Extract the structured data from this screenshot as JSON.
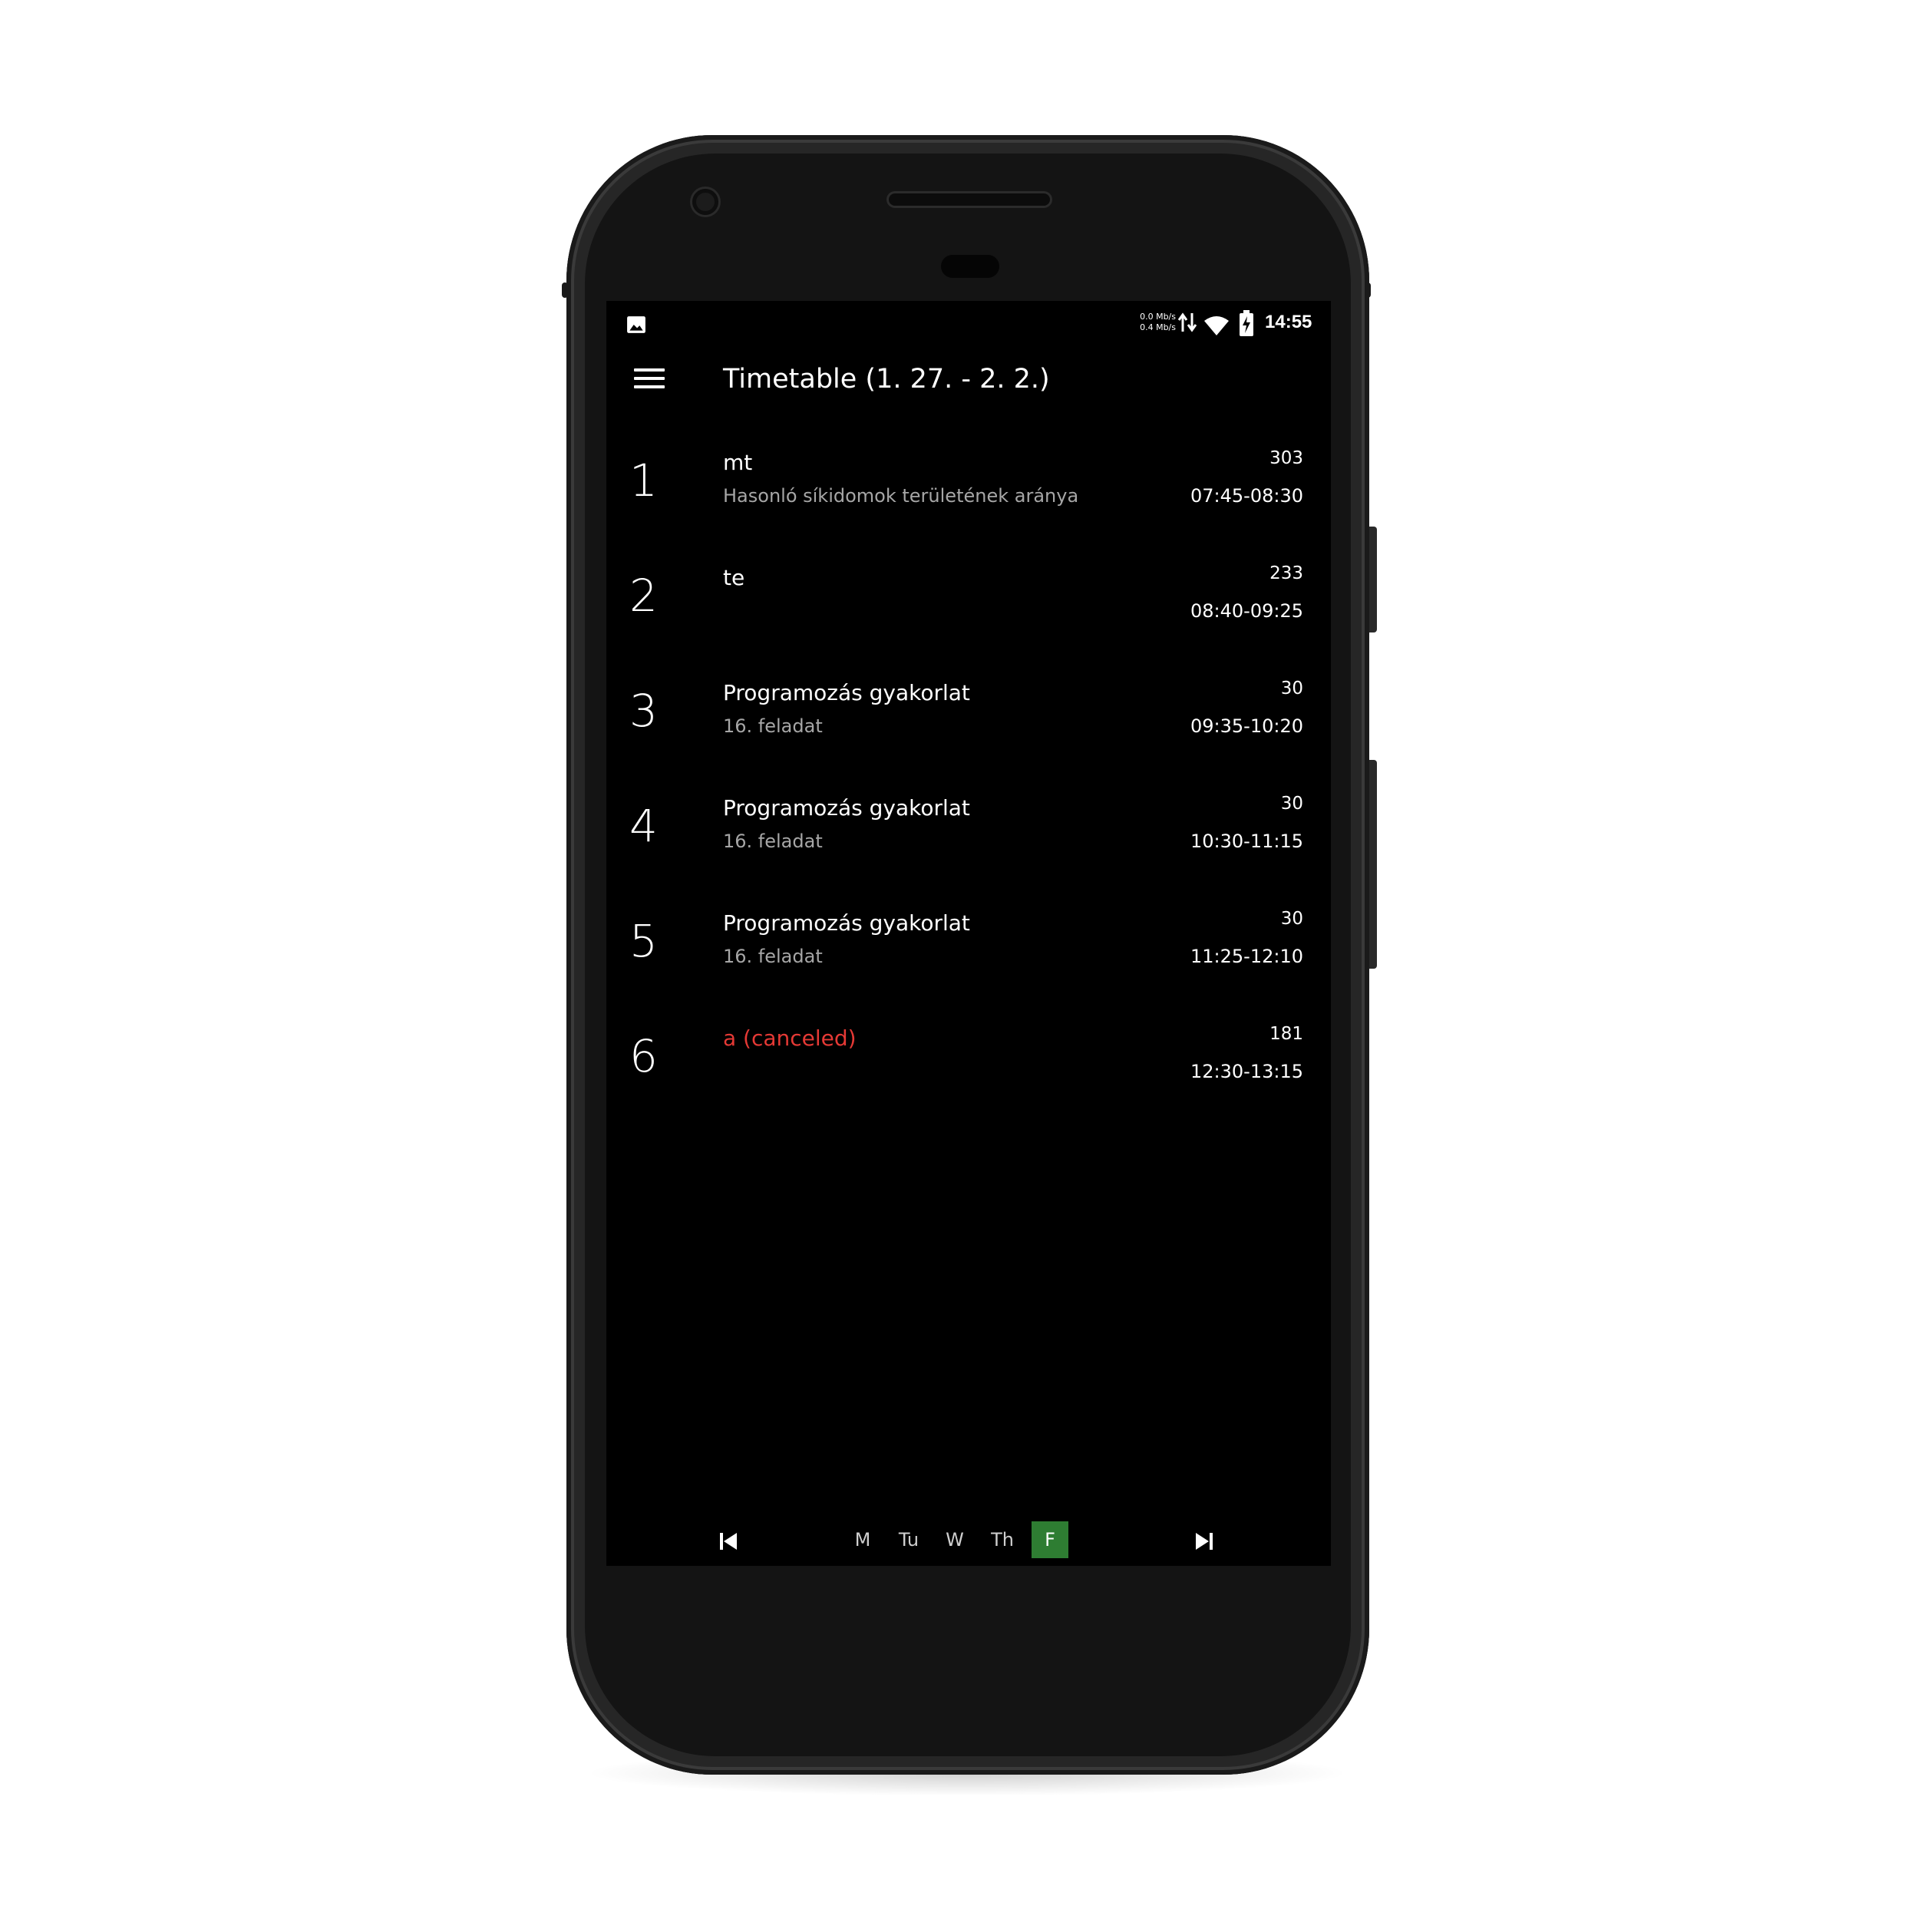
{
  "status_bar": {
    "speed_up": "0.0 Mb/s",
    "speed_down": "0.4 Mb/s",
    "time": "14:55"
  },
  "app_bar": {
    "title": "Timetable (1. 27. - 2. 2.)"
  },
  "lessons": [
    {
      "number": "1",
      "subject": "mt",
      "topic": "Hasonló síkidomok területének aránya",
      "room": "303",
      "time": "07:45-08:30",
      "canceled": false
    },
    {
      "number": "2",
      "subject": "te",
      "topic": "",
      "room": "233",
      "time": "08:40-09:25",
      "canceled": false
    },
    {
      "number": "3",
      "subject": "Programozás gyakorlat",
      "topic": "16. feladat",
      "room": "30",
      "time": "09:35-10:20",
      "canceled": false
    },
    {
      "number": "4",
      "subject": "Programozás gyakorlat",
      "topic": "16. feladat",
      "room": "30",
      "time": "10:30-11:15",
      "canceled": false
    },
    {
      "number": "5",
      "subject": "Programozás gyakorlat",
      "topic": "16. feladat",
      "room": "30",
      "time": "11:25-12:10",
      "canceled": false
    },
    {
      "number": "6",
      "subject": "a (canceled)",
      "topic": "",
      "room": "181",
      "time": "12:30-13:15",
      "canceled": true
    }
  ],
  "week_nav": {
    "days": [
      "M",
      "Tu",
      "W",
      "Th",
      "F"
    ],
    "selected": "F"
  },
  "colors": {
    "accent": "#2e7d32",
    "canceled": "#e53935",
    "background": "#000000"
  },
  "icons": {
    "menu": "hamburger-menu-icon",
    "prev_week": "skip-previous-icon",
    "next_week": "skip-next-icon"
  }
}
